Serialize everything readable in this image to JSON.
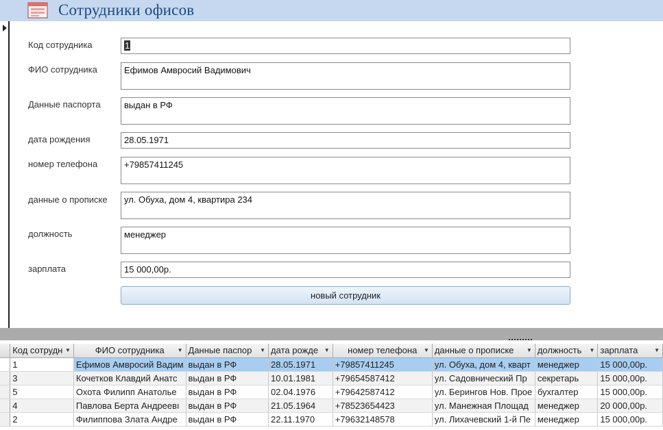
{
  "header": {
    "title": "Сотрудники офисов",
    "icon": "form-icon"
  },
  "form": {
    "fields": [
      {
        "key": "id",
        "label": "Код сотрудника",
        "value": "1"
      },
      {
        "key": "fio",
        "label": "ФИО сотрудника",
        "value": "Ефимов Амвросий Вадимович"
      },
      {
        "key": "passport",
        "label": "Данные паспорта",
        "value": "выдан в РФ"
      },
      {
        "key": "birth",
        "label": "дата рождения",
        "value": "28.05.1971"
      },
      {
        "key": "phone",
        "label": "номер телефона",
        "value": "+79857411245"
      },
      {
        "key": "address",
        "label": "данные о прописке",
        "value": "ул. Обуха, дом 4, квартира 234"
      },
      {
        "key": "position",
        "label": "должность",
        "value": "менеджер"
      },
      {
        "key": "salary",
        "label": "зарплата",
        "value": "15 000,00р."
      }
    ],
    "new_button": "новый сотрудник"
  },
  "datasheet": {
    "columns": [
      "Код сотрудн",
      "ФИО сотрудника",
      "Данные паспор",
      "дата рожде",
      "номер телефона",
      "данные о прописке",
      "должность",
      "зарплата"
    ],
    "rows": [
      [
        "1",
        "Ефимов Амвросий Вадим",
        "выдан в РФ",
        "28.05.1971",
        "+79857411245",
        "ул. Обуха, дом 4, кварт",
        "менеджер",
        "15 000,00р."
      ],
      [
        "3",
        "Кочетков Клавдий Анатс",
        "выдан в РФ",
        "10.01.1981",
        "+79654587412",
        " ул. Садовнический Пр",
        "секретарь",
        "15 000,00р."
      ],
      [
        "5",
        "Охота Филипп Анатолье",
        "выдан в РФ",
        "02.04.1976",
        "+79642587412",
        "ул. Берингов Нов. Прое",
        "бухгалтер",
        "15 000,00р."
      ],
      [
        "4",
        "Павлова Берта Андреевı",
        "выдан в РФ",
        "21.05.1964",
        "+78523654423",
        "ул. Манежная Площад",
        "менеджер",
        "20 000,00р."
      ],
      [
        "2",
        "Филиппова Злата Андре",
        "выдан в РФ",
        "22.11.1970",
        "+79632148578",
        "ул. Лихачевский 1-й Пе",
        "менеджер",
        "15 000,00р."
      ]
    ]
  },
  "colors": {
    "header_bg": "#c5d8f0",
    "title": "#1f497d",
    "selected_row": "#a8cdf0"
  }
}
